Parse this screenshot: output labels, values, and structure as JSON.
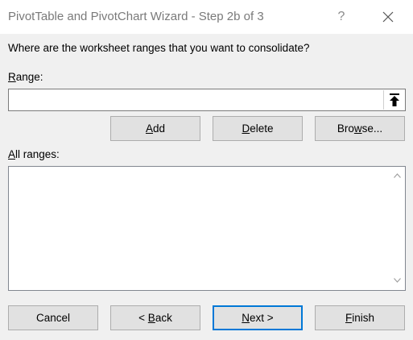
{
  "window": {
    "title": "PivotTable and PivotChart Wizard - Step 2b of 3",
    "help_label": "?"
  },
  "prompt": "Where are the worksheet ranges that you want to consolidate?",
  "range": {
    "label": "Range:",
    "value": "",
    "placeholder": ""
  },
  "range_buttons": {
    "add": "Add",
    "delete": "Delete",
    "browse": "Browse..."
  },
  "all_ranges": {
    "label": "All ranges:",
    "items": []
  },
  "footer": {
    "cancel": "Cancel",
    "back": "< Back",
    "next": "Next >",
    "finish": "Finish"
  },
  "colors": {
    "accent": "#0078d7",
    "button_face": "#e1e1e1",
    "dialog_bg": "#f0f0f0"
  },
  "icons": {
    "close": "close-icon",
    "collapse": "collapse-dialog-icon",
    "scroll_up": "chevron-up-icon",
    "scroll_down": "chevron-down-icon"
  }
}
